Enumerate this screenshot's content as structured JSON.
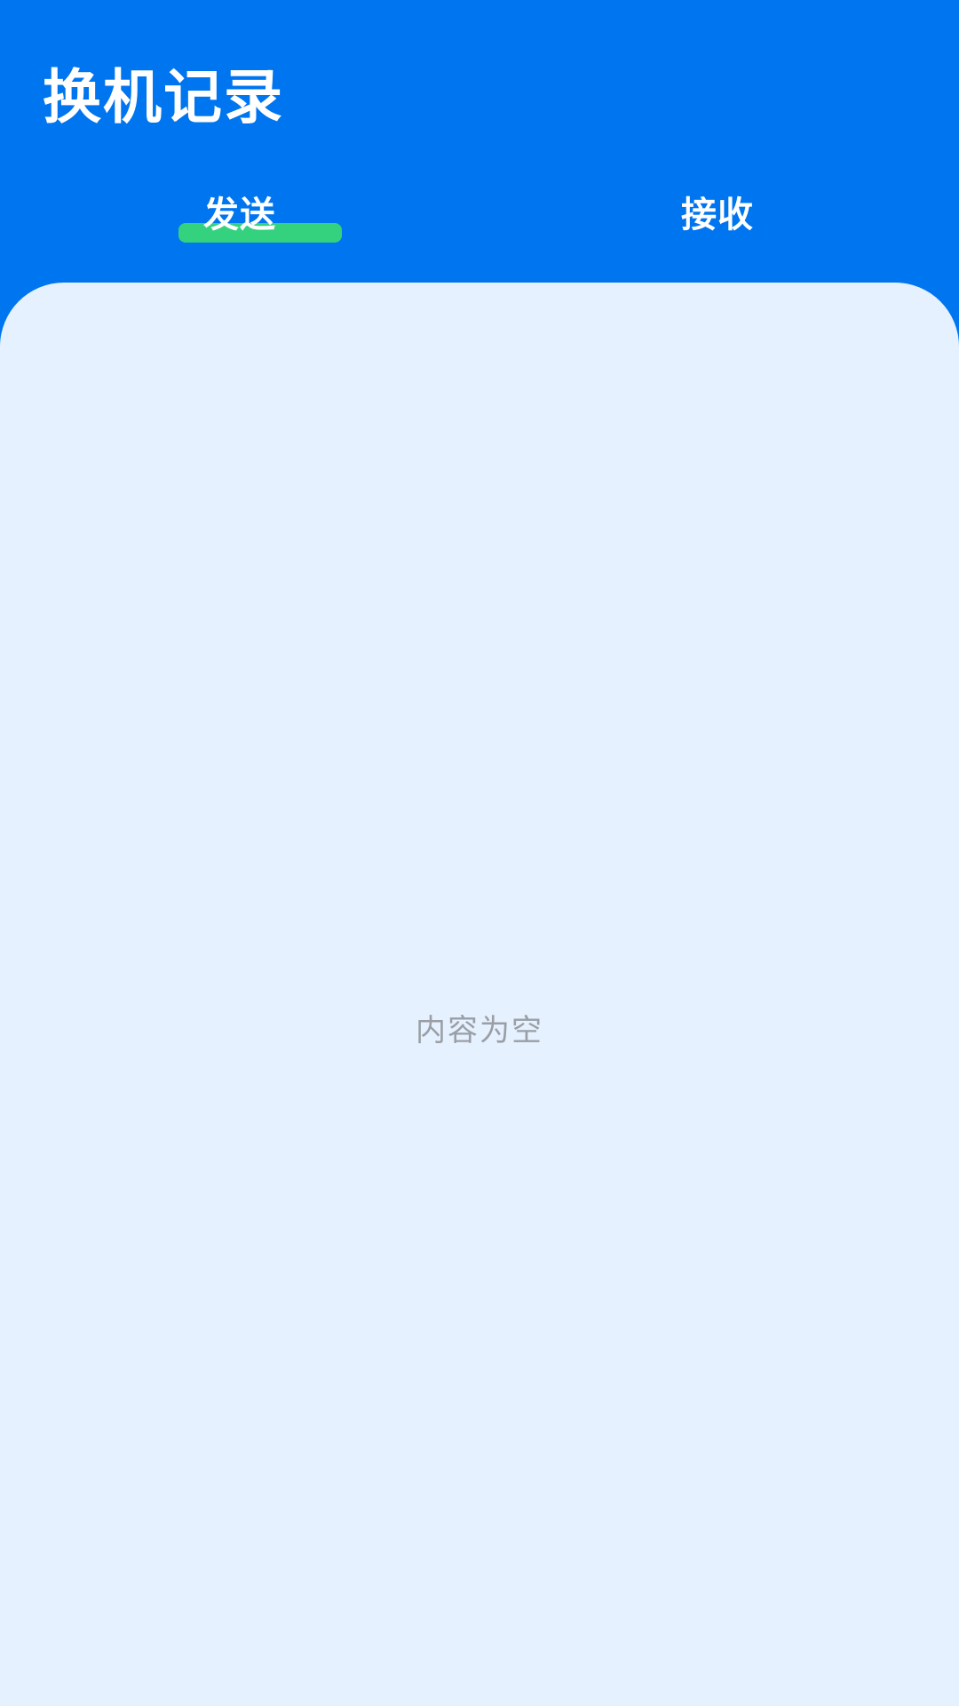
{
  "header": {
    "title": "换机记录"
  },
  "tabs": [
    {
      "label": "发送",
      "active": true
    },
    {
      "label": "接收",
      "active": false
    }
  ],
  "content": {
    "empty_text": "内容为空"
  },
  "colors": {
    "header_bg": "#0075f0",
    "content_bg": "#e5f1fe",
    "tab_indicator": "#34d27e",
    "title_text": "#ffffff",
    "empty_text": "#9a9ea6"
  }
}
